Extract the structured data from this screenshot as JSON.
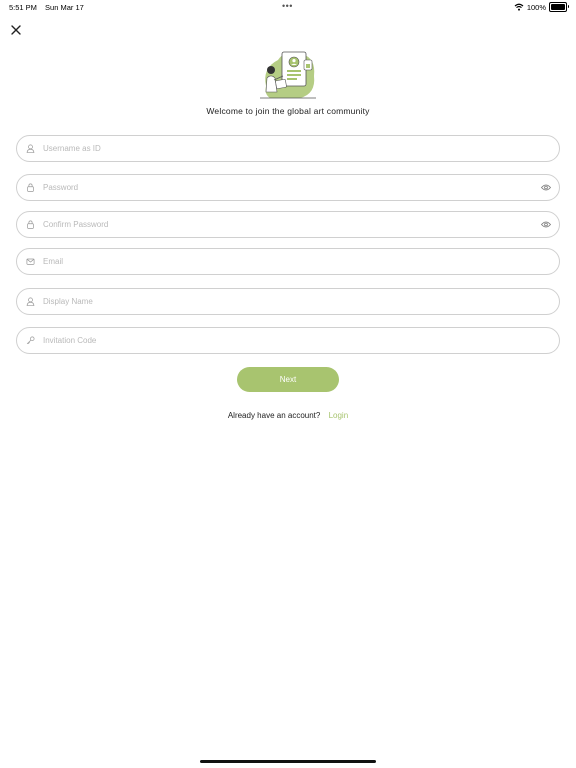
{
  "status_bar": {
    "time": "5:51 PM",
    "date": "Sun Mar 17",
    "dots": "•••",
    "battery_text": "100%",
    "battery_level": 1.0
  },
  "header": {
    "close_icon": "close-icon",
    "illustration": "registration-illustration"
  },
  "welcome_text": "Welcome to join the global art community",
  "form": {
    "username": {
      "placeholder": "Username as ID",
      "value": "",
      "icon": "user-icon"
    },
    "password": {
      "placeholder": "Password",
      "value": "",
      "icon": "lock-icon",
      "toggle_icon": "eye-icon"
    },
    "confirm_password": {
      "placeholder": "Confirm Password",
      "value": "",
      "icon": "lock-icon",
      "toggle_icon": "eye-icon"
    },
    "email": {
      "placeholder": "Email",
      "value": "",
      "icon": "mail-icon"
    },
    "display_name": {
      "placeholder": "Display Name",
      "value": "",
      "icon": "user-icon"
    },
    "invitation_code": {
      "placeholder": "Invitation Code",
      "value": "",
      "icon": "key-icon"
    }
  },
  "next_button": "Next",
  "login_prompt": {
    "text": "Already have an account?",
    "link": "Login"
  },
  "colors": {
    "accent": "#a8c46f",
    "field_border": "#d0d0d0",
    "placeholder": "#b9b9b9"
  }
}
